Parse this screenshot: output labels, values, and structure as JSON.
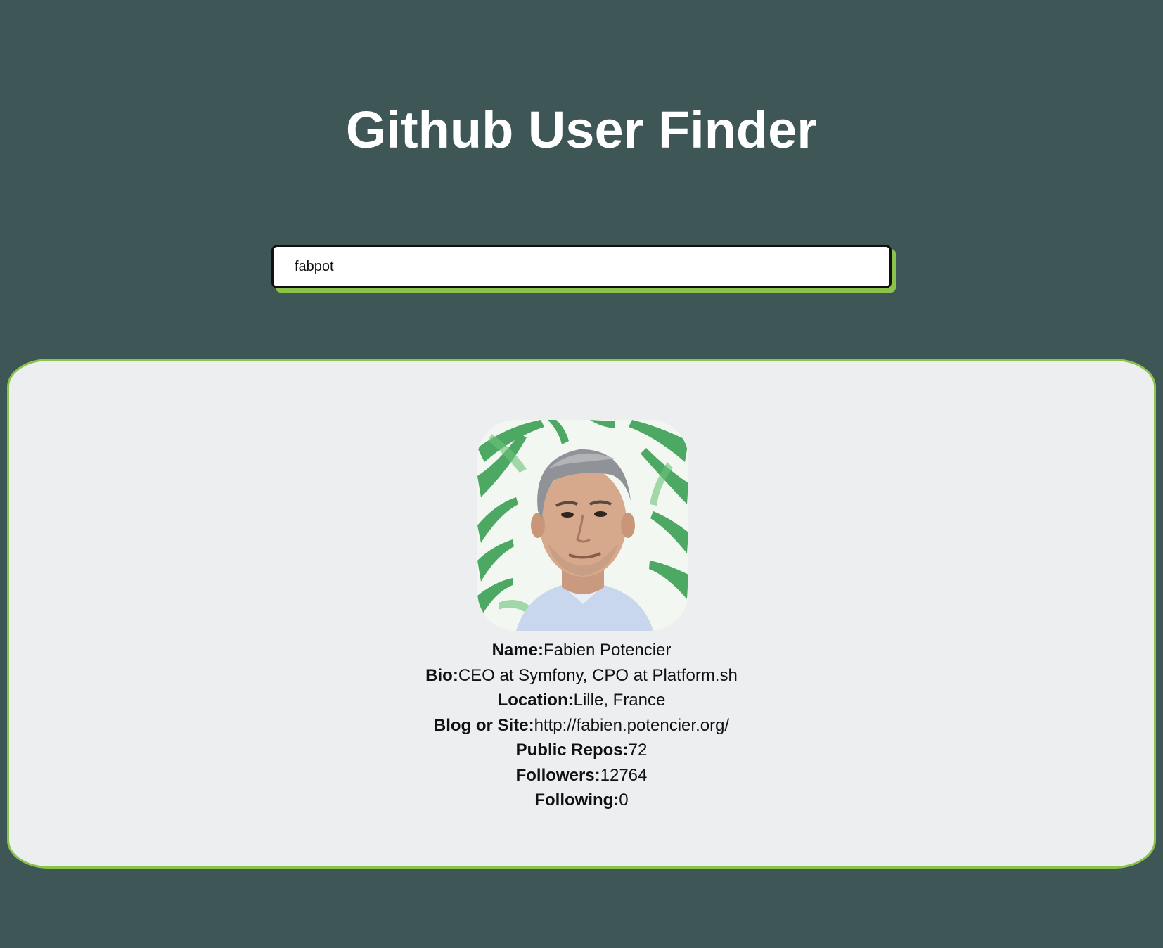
{
  "header": {
    "title": "Github User Finder"
  },
  "search": {
    "value": "fabpot"
  },
  "profile": {
    "fields": [
      {
        "label": "Name:",
        "value": "Fabien Potencier"
      },
      {
        "label": "Bio:",
        "value": "CEO at Symfony, CPO at Platform.sh"
      },
      {
        "label": "Location:",
        "value": "Lille, France"
      },
      {
        "label": "Blog or Site:",
        "value": "http://fabien.potencier.org/"
      },
      {
        "label": "Public Repos:",
        "value": "72"
      },
      {
        "label": "Followers:",
        "value": "12764"
      },
      {
        "label": "Following:",
        "value": "0"
      }
    ]
  },
  "colors": {
    "background": "#3e5756",
    "accent": "#8bc34a",
    "card": "#edeef0",
    "title": "#ffffff"
  }
}
